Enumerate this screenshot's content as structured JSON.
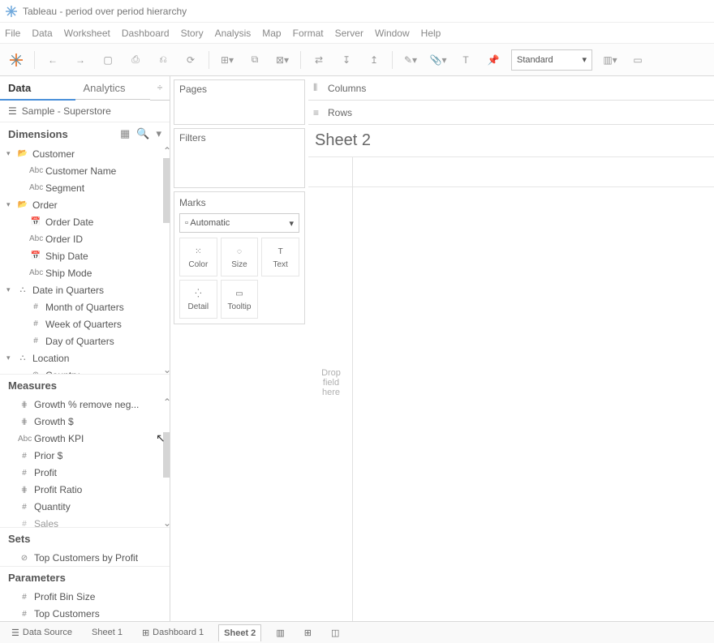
{
  "window": {
    "title": "Tableau - period over period hierarchy"
  },
  "menu": {
    "items": [
      "File",
      "Data",
      "Worksheet",
      "Dashboard",
      "Story",
      "Analysis",
      "Map",
      "Format",
      "Server",
      "Window",
      "Help"
    ]
  },
  "toolbar": {
    "presentation_mode": "Standard"
  },
  "side_tabs": {
    "data": "Data",
    "analytics": "Analytics"
  },
  "datasource": {
    "name": "Sample - Superstore"
  },
  "sections": {
    "dimensions": "Dimensions",
    "measures": "Measures",
    "sets": "Sets",
    "parameters": "Parameters"
  },
  "dim_tree": [
    {
      "indent": 0,
      "caret": "▾",
      "icon": "📂",
      "label": "Customer"
    },
    {
      "indent": 2,
      "caret": "",
      "icon": "Abc",
      "label": "Customer Name"
    },
    {
      "indent": 2,
      "caret": "",
      "icon": "Abc",
      "label": "Segment"
    },
    {
      "indent": 0,
      "caret": "▾",
      "icon": "📂",
      "label": "Order"
    },
    {
      "indent": 2,
      "caret": "",
      "icon": "📅",
      "label": "Order Date"
    },
    {
      "indent": 2,
      "caret": "",
      "icon": "Abc",
      "label": "Order ID"
    },
    {
      "indent": 2,
      "caret": "",
      "icon": "📅",
      "label": "Ship Date"
    },
    {
      "indent": 2,
      "caret": "",
      "icon": "Abc",
      "label": "Ship Mode"
    },
    {
      "indent": 0,
      "caret": "▾",
      "icon": "⛬",
      "label": "Date in Quarters"
    },
    {
      "indent": 2,
      "caret": "",
      "icon": "#",
      "label": "Month of Quarters"
    },
    {
      "indent": 2,
      "caret": "",
      "icon": "#",
      "label": "Week of Quarters"
    },
    {
      "indent": 2,
      "caret": "",
      "icon": "#",
      "label": "Day of Quarters"
    },
    {
      "indent": 0,
      "caret": "▾",
      "icon": "⛬",
      "label": "Location"
    },
    {
      "indent": 2,
      "caret": "",
      "icon": "⊕",
      "label": "Country"
    }
  ],
  "meas_tree": [
    {
      "icon": "⋕",
      "label": "Growth % remove neg..."
    },
    {
      "icon": "⋕",
      "label": "Growth $"
    },
    {
      "icon": "Abc",
      "label": "Growth KPI"
    },
    {
      "icon": "#",
      "label": "Prior $"
    },
    {
      "icon": "#",
      "label": "Profit"
    },
    {
      "icon": "⋕",
      "label": "Profit Ratio"
    },
    {
      "icon": "#",
      "label": "Quantity"
    },
    {
      "icon": "#",
      "label": "Sales"
    }
  ],
  "sets_tree": [
    {
      "icon": "⊘",
      "label": "Top Customers by Profit"
    }
  ],
  "param_tree": [
    {
      "icon": "#",
      "label": "Profit Bin Size"
    },
    {
      "icon": "#",
      "label": "Top Customers"
    }
  ],
  "shelves": {
    "pages": "Pages",
    "filters": "Filters",
    "marks": "Marks",
    "mark_type": "Automatic",
    "mark_cells": [
      "Color",
      "Size",
      "Text",
      "Detail",
      "Tooltip"
    ],
    "columns": "Columns",
    "rows": "Rows"
  },
  "sheet": {
    "title": "Sheet 2",
    "drop_hint": "Drop field here"
  },
  "footer": {
    "data_source": "Data Source",
    "tabs": [
      "Sheet 1",
      "Dashboard 1",
      "Sheet 2"
    ]
  }
}
